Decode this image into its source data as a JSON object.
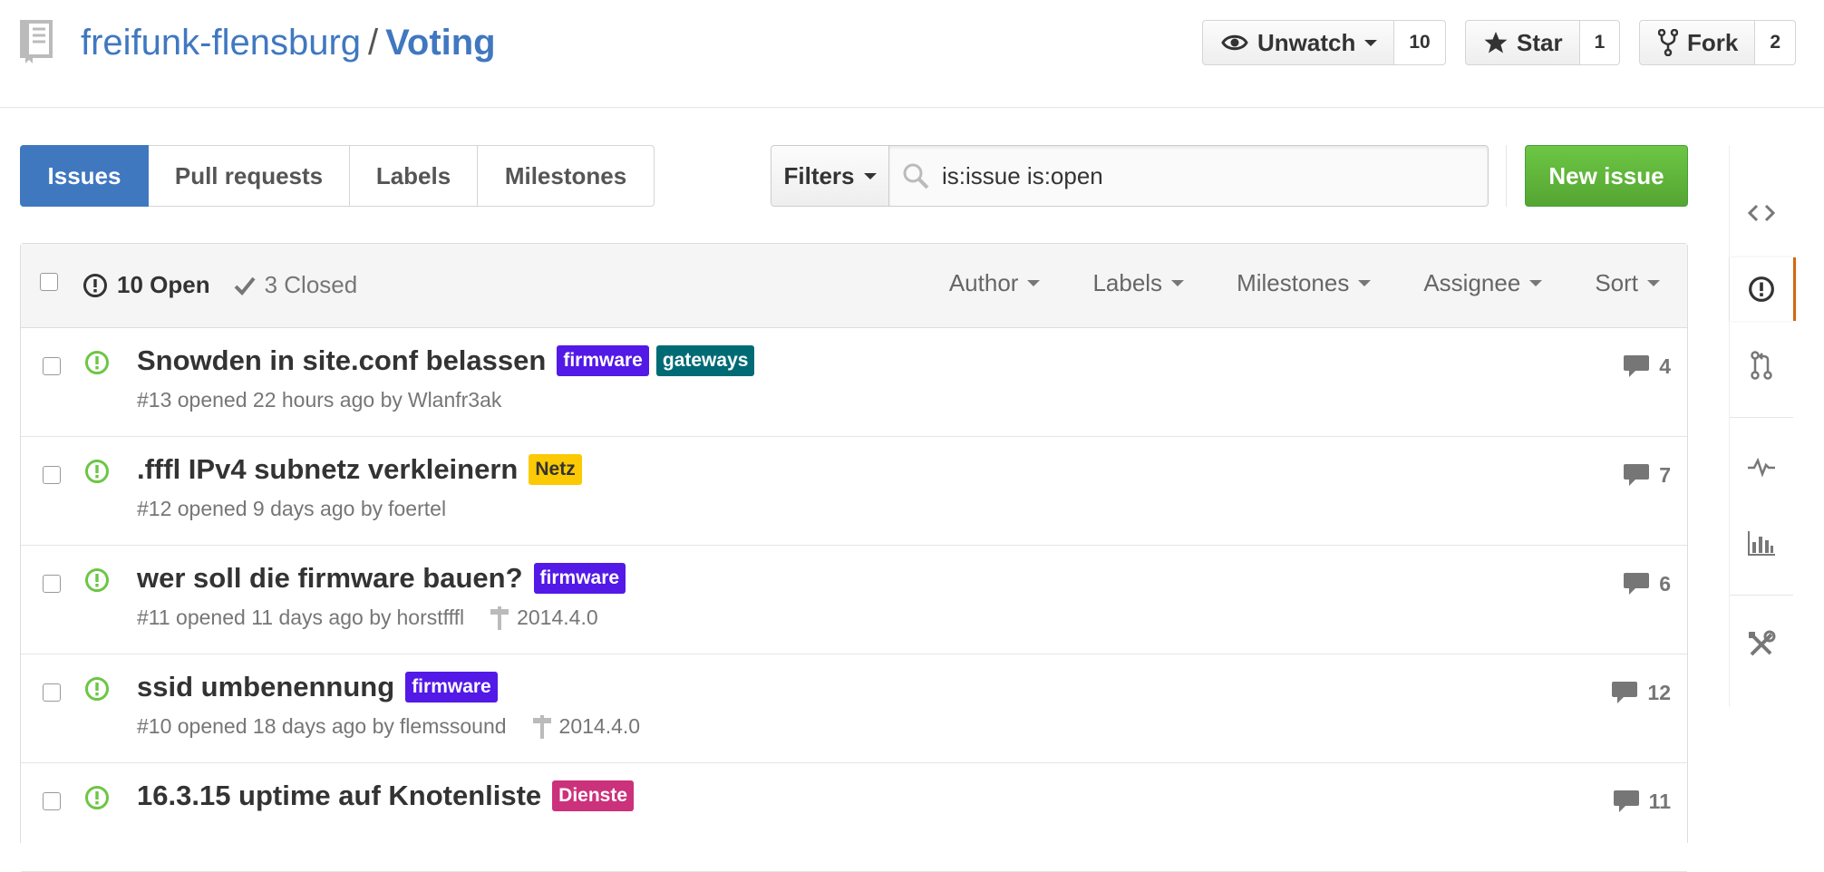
{
  "repo": {
    "owner": "freifunk-flensburg",
    "separator": "/",
    "name": "Voting"
  },
  "actions": {
    "watch": {
      "label": "Unwatch",
      "count": "10"
    },
    "star": {
      "label": "Star",
      "count": "1"
    },
    "fork": {
      "label": "Fork",
      "count": "2"
    }
  },
  "nav": {
    "issues": "Issues",
    "pull_requests": "Pull requests",
    "labels": "Labels",
    "milestones": "Milestones"
  },
  "search": {
    "filters_label": "Filters",
    "value": "is:issue is:open"
  },
  "new_issue_label": "New issue",
  "list_header": {
    "open": "10 Open",
    "closed": "3 Closed",
    "filters": [
      "Author",
      "Labels",
      "Milestones",
      "Assignee",
      "Sort"
    ]
  },
  "issues": [
    {
      "title": "Snowden in site.conf belassen",
      "labels": [
        {
          "name": "firmware",
          "color": "#5319e7"
        },
        {
          "name": "gateways",
          "color": "#006b75"
        }
      ],
      "meta": "#13 opened 22 hours ago by",
      "author": "Wlanfr3ak",
      "milestone": "",
      "comments": "4"
    },
    {
      "title": ".fffl IPv4 subnetz verkleinern",
      "labels": [
        {
          "name": "Netz",
          "color": "#fbca04"
        }
      ],
      "meta": "#12 opened 9 days ago by",
      "author": "foertel",
      "milestone": "",
      "comments": "7"
    },
    {
      "title": "wer soll die firmware bauen?",
      "labels": [
        {
          "name": "firmware",
          "color": "#5319e7"
        }
      ],
      "meta": "#11 opened 11 days ago by",
      "author": "horstfffl",
      "milestone": "2014.4.0",
      "comments": "6"
    },
    {
      "title": "ssid umbenennung",
      "labels": [
        {
          "name": "firmware",
          "color": "#5319e7"
        }
      ],
      "meta": "#10 opened 18 days ago by",
      "author": "flemssound",
      "milestone": "2014.4.0",
      "comments": "12"
    },
    {
      "title": "16.3.15 uptime auf Knotenliste",
      "labels": [
        {
          "name": "Dienste",
          "color": "#cc317c"
        }
      ],
      "meta": "",
      "author": "",
      "milestone": "",
      "comments": "11"
    }
  ],
  "colors": {
    "link": "#4078c0",
    "open_icon": "#6cc644",
    "new_issue_bg": "#6cc644",
    "selected_tab": "#4078c0",
    "sidebar_active": "#d26911"
  },
  "sidebar_icons": [
    "code-icon",
    "issue-opened-icon",
    "git-pull-request-icon",
    "pulse-icon",
    "graph-icon",
    "tools-icon"
  ]
}
